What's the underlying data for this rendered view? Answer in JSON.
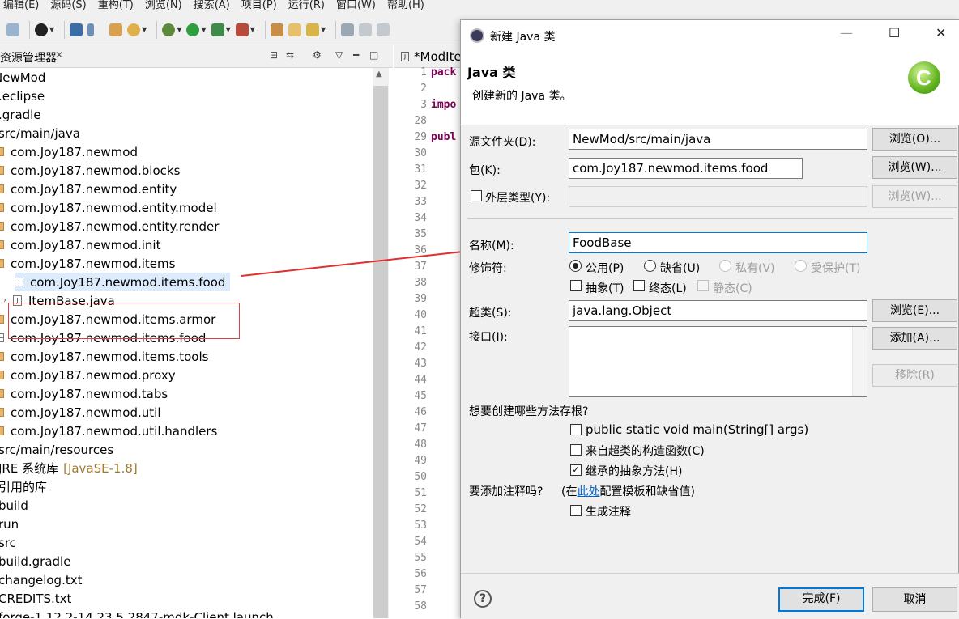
{
  "menubar": {
    "items": [
      "编辑(E)",
      "源码(S)",
      "重构(T)",
      "浏览(N)",
      "搜索(A)",
      "项目(P)",
      "运行(R)",
      "窗口(W)",
      "帮助(H)"
    ]
  },
  "toolbar": {
    "icons": [
      "copy-icon",
      "user-icon",
      "console-icon",
      "pin-icon",
      "package-icon",
      "refresh-icon",
      "debug-icon",
      "run-icon",
      "run-config-icon",
      "external-tools-icon",
      "open-type-icon",
      "open-folder-icon",
      "search-icon",
      "annotation-icon",
      "pen-icon",
      "back-icon"
    ]
  },
  "explorer": {
    "title": "资源管理器",
    "close": "✕",
    "tree": [
      {
        "text": "NewMod",
        "icon": "project"
      },
      {
        "text": ".eclipse",
        "icon": "folder"
      },
      {
        "text": ".gradle",
        "icon": "folder"
      },
      {
        "text": "src/main/java",
        "icon": "srcfolder"
      },
      {
        "text": "com.Joy187.newmod",
        "icon": "pkg"
      },
      {
        "text": "com.Joy187.newmod.blocks",
        "icon": "pkg"
      },
      {
        "text": "com.Joy187.newmod.entity",
        "icon": "pkg"
      },
      {
        "text": "com.Joy187.newmod.entity.model",
        "icon": "pkg"
      },
      {
        "text": "com.Joy187.newmod.entity.render",
        "icon": "pkg"
      },
      {
        "text": "com.Joy187.newmod.init",
        "icon": "pkg"
      },
      {
        "text": "com.Joy187.newmod.items",
        "icon": "pkg"
      },
      {
        "text": "com.Joy187.newmod.items.food",
        "icon": "pkg-empty"
      },
      {
        "text": "ItemBase.java",
        "icon": "java"
      },
      {
        "text": "com.Joy187.newmod.items.armor",
        "icon": "pkg"
      },
      {
        "text": "com.Joy187.newmod.items.food",
        "icon": "pkg-empty"
      },
      {
        "text": "com.Joy187.newmod.items.tools",
        "icon": "pkg"
      },
      {
        "text": "com.Joy187.newmod.proxy",
        "icon": "pkg"
      },
      {
        "text": "com.Joy187.newmod.tabs",
        "icon": "pkg"
      },
      {
        "text": "com.Joy187.newmod.util",
        "icon": "pkg"
      },
      {
        "text": "com.Joy187.newmod.util.handlers",
        "icon": "pkg"
      },
      {
        "text": "src/main/resources",
        "icon": "srcfolder"
      },
      {
        "text": "JRE 系统库",
        "suffix": "[JavaSE-1.8]",
        "icon": "library"
      },
      {
        "text": "引用的库",
        "icon": "library"
      },
      {
        "text": "build",
        "icon": "folder"
      },
      {
        "text": "run",
        "icon": "folder"
      },
      {
        "text": "src",
        "icon": "folder"
      },
      {
        "text": "build.gradle",
        "icon": "file"
      },
      {
        "text": "changelog.txt",
        "icon": "file"
      },
      {
        "text": "CREDITS.txt",
        "icon": "file"
      },
      {
        "text": "forge-1.12.2-14.23.5.2847-mdk-Client.launch",
        "icon": "file"
      }
    ]
  },
  "editor": {
    "tab_label": "*ModIte",
    "line_numbers": [
      "1",
      "2",
      "3",
      "28",
      "29",
      "30",
      "31",
      "32",
      "33",
      "34",
      "35",
      "36",
      "37",
      "38",
      "39",
      "40",
      "41",
      "42",
      "43",
      "44",
      "45",
      "46",
      "47",
      "48",
      "49",
      "50",
      "51",
      "52",
      "53",
      "54",
      "55",
      "56",
      "57",
      "58"
    ],
    "code": {
      "line1": "pack",
      "line3": "impo",
      "line29": "publ"
    }
  },
  "dialog": {
    "title": "新建 Java 类",
    "banner_title": "Java 类",
    "banner_desc": "创建新的 Java 类。",
    "source_folder": {
      "label": "源文件夹(D):",
      "value": "NewMod/src/main/java",
      "browse": "浏览(O)..."
    },
    "package": {
      "label": "包(K):",
      "value": "com.Joy187.newmod.items.food",
      "browse": "浏览(W)..."
    },
    "enclosing": {
      "label": "外层类型(Y):",
      "value": "",
      "browse": "浏览(W)..."
    },
    "name": {
      "label": "名称(M):",
      "value": "FoodBase"
    },
    "modifiers": {
      "label": "修饰符:",
      "public": "公用(P)",
      "default": "缺省(U)",
      "private": "私有(V)",
      "protected": "受保护(T)",
      "abstract": "抽象(T)",
      "final": "终态(L)",
      "static": "静态(C)"
    },
    "superclass": {
      "label": "超类(S):",
      "value": "java.lang.Object",
      "browse": "浏览(E)..."
    },
    "interfaces": {
      "label": "接口(I):",
      "add": "添加(A)...",
      "remove": "移除(R)"
    },
    "stubs": {
      "question": "想要创建哪些方法存根?",
      "main": "public static void main(String[] args)",
      "constructors": "来自超类的构造函数(C)",
      "inherited": "继承的抽象方法(H)",
      "inherited_checked": true
    },
    "comments": {
      "question": "要添加注释吗?",
      "hint_pre": "(在",
      "hint_link": "此处",
      "hint_post": "配置模板和缺省值)",
      "generate": "生成注释"
    },
    "finish": "完成(F)",
    "cancel": "取消",
    "help": "?",
    "check_mark": "✓"
  }
}
